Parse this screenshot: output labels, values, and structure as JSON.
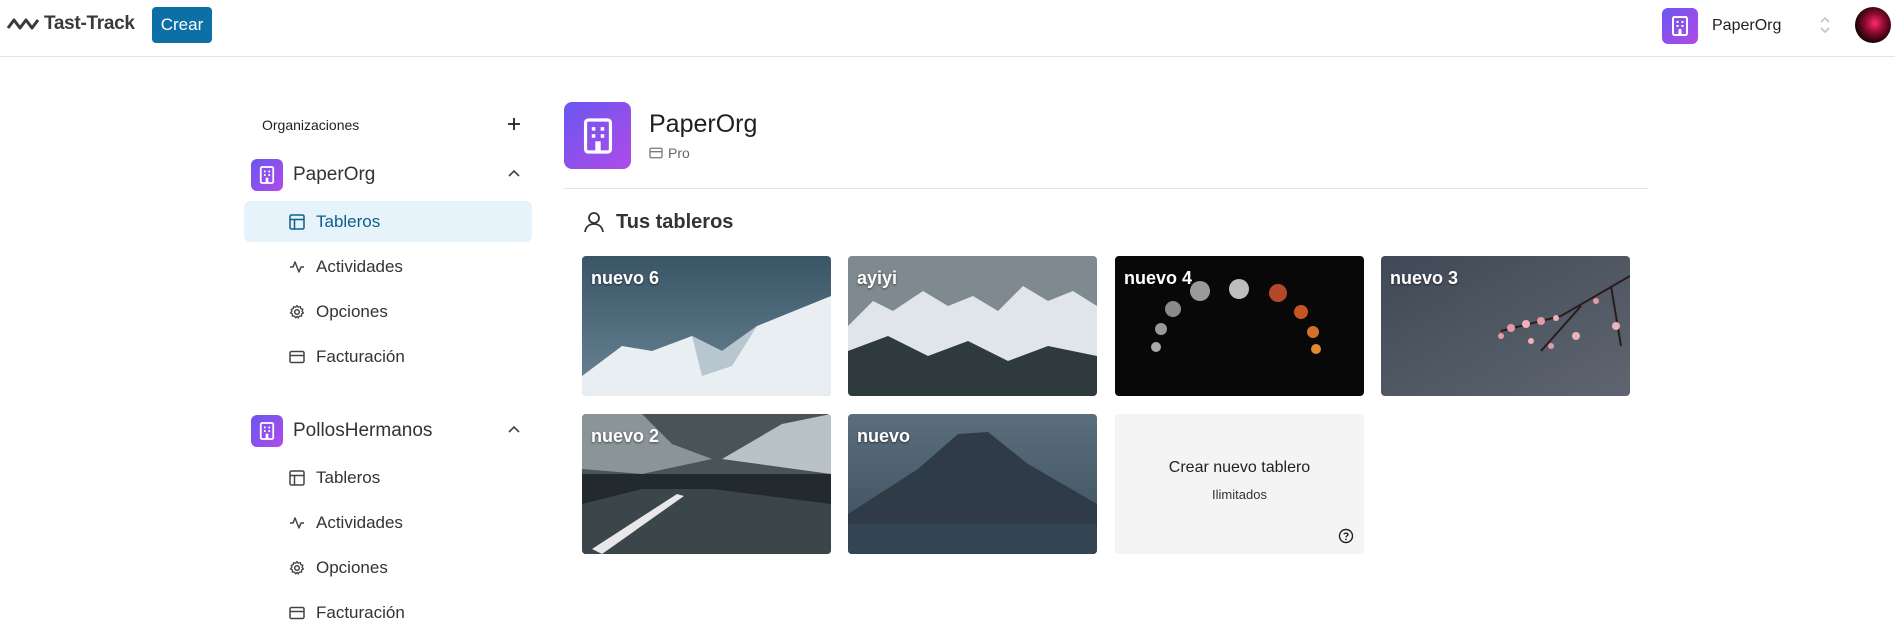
{
  "app": {
    "logo_text": "Tast-Track",
    "create_label": "Crear"
  },
  "org_switcher": {
    "name": "PaperOrg"
  },
  "sidebar": {
    "header": "Organizaciones",
    "orgs": [
      {
        "name": "PaperOrg",
        "expanded": true,
        "items": [
          {
            "label": "Tableros",
            "icon": "layout-icon",
            "active": true
          },
          {
            "label": "Actividades",
            "icon": "activity-icon",
            "active": false
          },
          {
            "label": "Opciones",
            "icon": "settings-icon",
            "active": false
          },
          {
            "label": "Facturación",
            "icon": "credit-card-icon",
            "active": false
          }
        ]
      },
      {
        "name": "PollosHermanos",
        "expanded": true,
        "items": [
          {
            "label": "Tableros",
            "icon": "layout-icon",
            "active": false
          },
          {
            "label": "Actividades",
            "icon": "activity-icon",
            "active": false
          },
          {
            "label": "Opciones",
            "icon": "settings-icon",
            "active": false
          },
          {
            "label": "Facturación",
            "icon": "credit-card-icon",
            "active": false
          }
        ]
      }
    ]
  },
  "main": {
    "org_name": "PaperOrg",
    "plan": "Pro",
    "section_title": "Tus tableros",
    "boards": [
      {
        "title": "nuevo 6"
      },
      {
        "title": "ayiyi"
      },
      {
        "title": "nuevo 4"
      },
      {
        "title": "nuevo 3"
      },
      {
        "title": "nuevo 2"
      },
      {
        "title": "nuevo"
      }
    ],
    "create_card": {
      "title": "Crear nuevo tablero",
      "subtitle": "Ilimitados"
    }
  },
  "colors": {
    "accent": "#0c6fa6",
    "org_badge_start": "#6a56f0",
    "org_badge_end": "#b04be8",
    "active_nav_bg": "#e7f3fb"
  }
}
